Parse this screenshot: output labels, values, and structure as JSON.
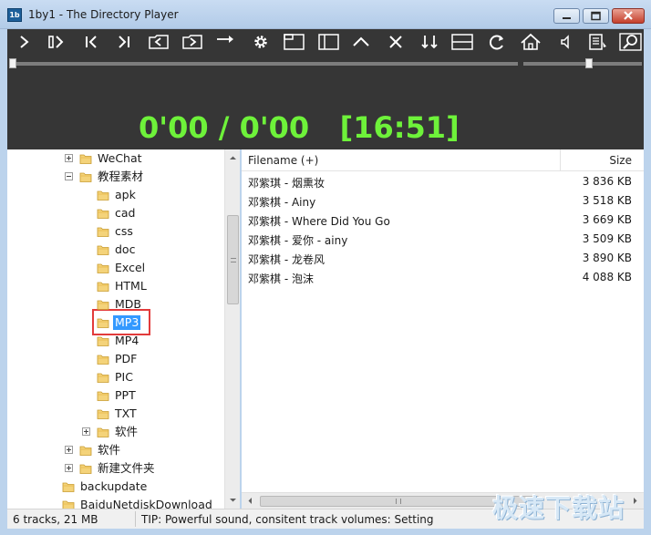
{
  "window": {
    "title": "1by1 - The Directory Player",
    "icon_text": "1b"
  },
  "toolbar": {
    "buttons": [
      "play-icon",
      "next-track-icon",
      "previous-icon",
      "skip-next-icon",
      "folder-back-icon",
      "folder-forward-icon",
      "jump-arrow-icon",
      "settings-gear-icon",
      "layout-window-icon",
      "sidebar-layout-icon",
      "chevron-up-icon",
      "close-x-icon",
      "sort-icon",
      "split-view-icon",
      "refresh-icon",
      "home-icon",
      "volume-icon",
      "playlist-icon",
      "search-icon"
    ]
  },
  "player": {
    "time": "0'00 / 0'00",
    "clock": "[16:51]",
    "seek_position": 0,
    "volume_level": 0.55
  },
  "tree": {
    "items": [
      {
        "label": "WeChat",
        "expander": "plus"
      },
      {
        "label": "教程素材",
        "expander": "minus"
      },
      {
        "label": "apk"
      },
      {
        "label": "cad"
      },
      {
        "label": "css"
      },
      {
        "label": "doc"
      },
      {
        "label": "Excel"
      },
      {
        "label": "HTML"
      },
      {
        "label": "MDB"
      },
      {
        "label": "MP3",
        "selected": true
      },
      {
        "label": "MP4"
      },
      {
        "label": "PDF"
      },
      {
        "label": "PIC"
      },
      {
        "label": "PPT"
      },
      {
        "label": "TXT"
      },
      {
        "label": "软件",
        "expander": "plus"
      },
      {
        "label": "软件",
        "expander": "plus"
      },
      {
        "label": "新建文件夹",
        "expander": "plus"
      },
      {
        "label": "backupdate"
      },
      {
        "label": "BaiduNetdiskDownload"
      }
    ]
  },
  "file_list": {
    "header_name": "Filename (+)",
    "header_size": "Size",
    "rows": [
      {
        "name": "邓紫琪 - 烟熏妆",
        "size": "3 836 KB"
      },
      {
        "name": "邓紫棋 - Ainy",
        "size": "3 518 KB"
      },
      {
        "name": "邓紫棋 - Where Did You Go",
        "size": "3 669 KB"
      },
      {
        "name": "邓紫棋 - 爱你 - ainy",
        "size": "3 509 KB"
      },
      {
        "name": "邓紫棋 - 龙卷风",
        "size": "3 890 KB"
      },
      {
        "name": "邓紫棋 - 泡沫",
        "size": "4 088 KB"
      }
    ]
  },
  "status": {
    "summary": "6 tracks, 21 MB",
    "tip": "TIP: Powerful sound, consitent track volumes: Setting"
  },
  "watermark": "极速下载站",
  "colors": {
    "time_display": "#6ef23a",
    "player_bg": "#363636",
    "selection": "#3399ff",
    "highlight_box": "#e23b3b"
  }
}
